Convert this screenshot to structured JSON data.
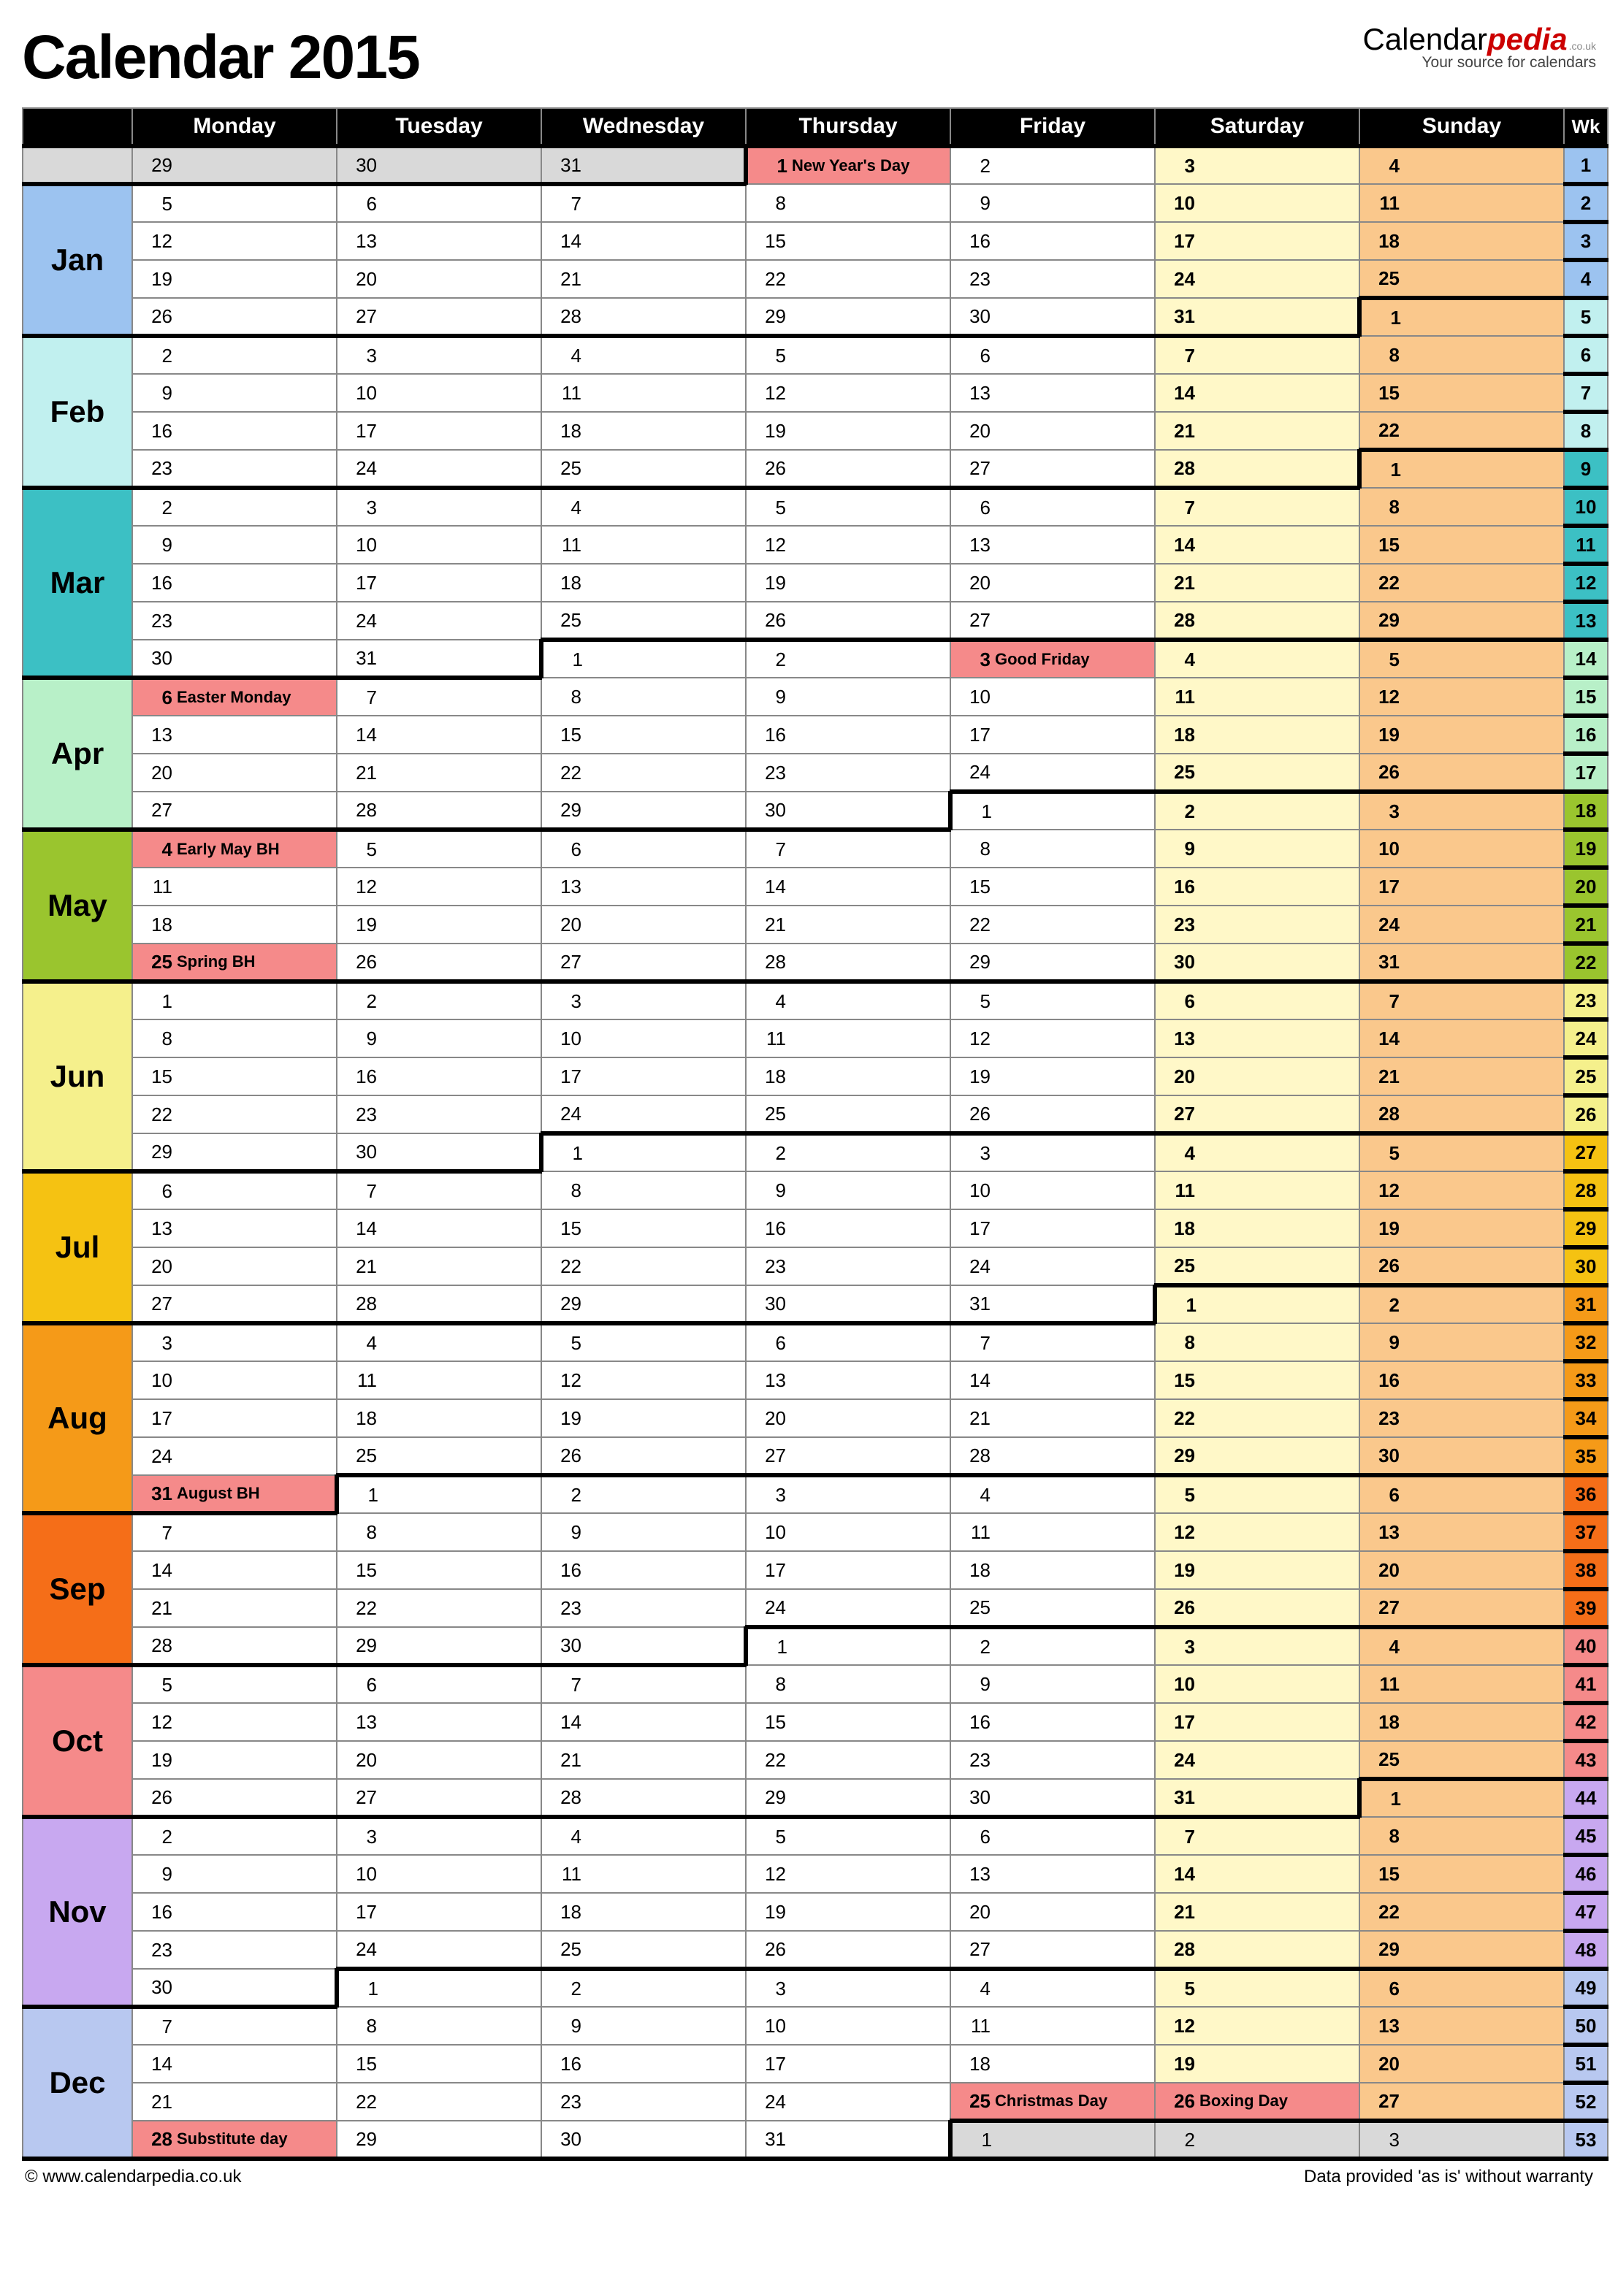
{
  "title": "Calendar 2015",
  "brand": {
    "part1": "Calendar",
    "part2": "pedia",
    "tld": ".co.uk",
    "tagline": "Your source for calendars"
  },
  "footer": {
    "left": "© www.calendarpedia.co.uk",
    "right": "Data provided 'as is' without warranty"
  },
  "day_headers": [
    "Monday",
    "Tuesday",
    "Wednesday",
    "Thursday",
    "Friday",
    "Saturday",
    "Sunday"
  ],
  "wk_header": "Wk",
  "month_colors": {
    "Jan": "#9cc3f0",
    "Feb": "#c1f0ef",
    "Mar": "#3cc0c4",
    "Apr": "#b8f0c8",
    "May": "#9ac52e",
    "Jun": "#f5f08c",
    "Jul": "#f5c212",
    "Aug": "#f59a18",
    "Sep": "#f56e18",
    "Oct": "#f58a8a",
    "Nov": "#c8a8f0",
    "Dec": "#b8c8f0"
  },
  "wk_colors": {
    "1": "#9cc3f0",
    "2": "#9cc3f0",
    "3": "#9cc3f0",
    "4": "#9cc3f0",
    "5": "#c1f0ef",
    "6": "#c1f0ef",
    "7": "#c1f0ef",
    "8": "#c1f0ef",
    "9": "#3cc0c4",
    "10": "#3cc0c4",
    "11": "#3cc0c4",
    "12": "#3cc0c4",
    "13": "#3cc0c4",
    "14": "#b8f0c8",
    "15": "#b8f0c8",
    "16": "#b8f0c8",
    "17": "#b8f0c8",
    "18": "#9ac52e",
    "19": "#9ac52e",
    "20": "#9ac52e",
    "21": "#9ac52e",
    "22": "#9ac52e",
    "23": "#f5f08c",
    "24": "#f5f08c",
    "25": "#f5f08c",
    "26": "#f5f08c",
    "27": "#f5c212",
    "28": "#f5c212",
    "29": "#f5c212",
    "30": "#f5c212",
    "31": "#f59a18",
    "32": "#f59a18",
    "33": "#f59a18",
    "34": "#f59a18",
    "35": "#f59a18",
    "36": "#f56e18",
    "37": "#f56e18",
    "38": "#f56e18",
    "39": "#f56e18",
    "40": "#f58a8a",
    "41": "#f58a8a",
    "42": "#f58a8a",
    "43": "#f58a8a",
    "44": "#c8a8f0",
    "45": "#c8a8f0",
    "46": "#c8a8f0",
    "47": "#c8a8f0",
    "48": "#c8a8f0",
    "49": "#b8c8f0",
    "50": "#b8c8f0",
    "51": "#b8c8f0",
    "52": "#b8c8f0",
    "53": "#b8c8f0"
  },
  "months": [
    {
      "name": "Jan",
      "first_dow": 3,
      "days": 31,
      "prev_days": 31
    },
    {
      "name": "Feb",
      "first_dow": 6,
      "days": 28,
      "prev_days": 31
    },
    {
      "name": "Mar",
      "first_dow": 6,
      "days": 31,
      "prev_days": 28
    },
    {
      "name": "Apr",
      "first_dow": 2,
      "days": 30,
      "prev_days": 31
    },
    {
      "name": "May",
      "first_dow": 4,
      "days": 31,
      "prev_days": 30
    },
    {
      "name": "Jun",
      "first_dow": 0,
      "days": 30,
      "prev_days": 31
    },
    {
      "name": "Jul",
      "first_dow": 2,
      "days": 31,
      "prev_days": 30
    },
    {
      "name": "Aug",
      "first_dow": 5,
      "days": 31,
      "prev_days": 31
    },
    {
      "name": "Sep",
      "first_dow": 1,
      "days": 30,
      "prev_days": 31
    },
    {
      "name": "Oct",
      "first_dow": 3,
      "days": 31,
      "prev_days": 30
    },
    {
      "name": "Nov",
      "first_dow": 6,
      "days": 30,
      "prev_days": 31
    },
    {
      "name": "Dec",
      "first_dow": 1,
      "days": 31,
      "prev_days": 30
    }
  ],
  "holidays": {
    "Jan-1": "New Year's Day",
    "Apr-3": "Good Friday",
    "Apr-6": "Easter Monday",
    "May-4": "Early May BH",
    "May-25": "Spring BH",
    "Aug-31": "August BH",
    "Dec-25": "Christmas Day",
    "Dec-26": "Boxing Day",
    "Dec-28": "Substitute day"
  },
  "trailing_next_year_days": 3
}
